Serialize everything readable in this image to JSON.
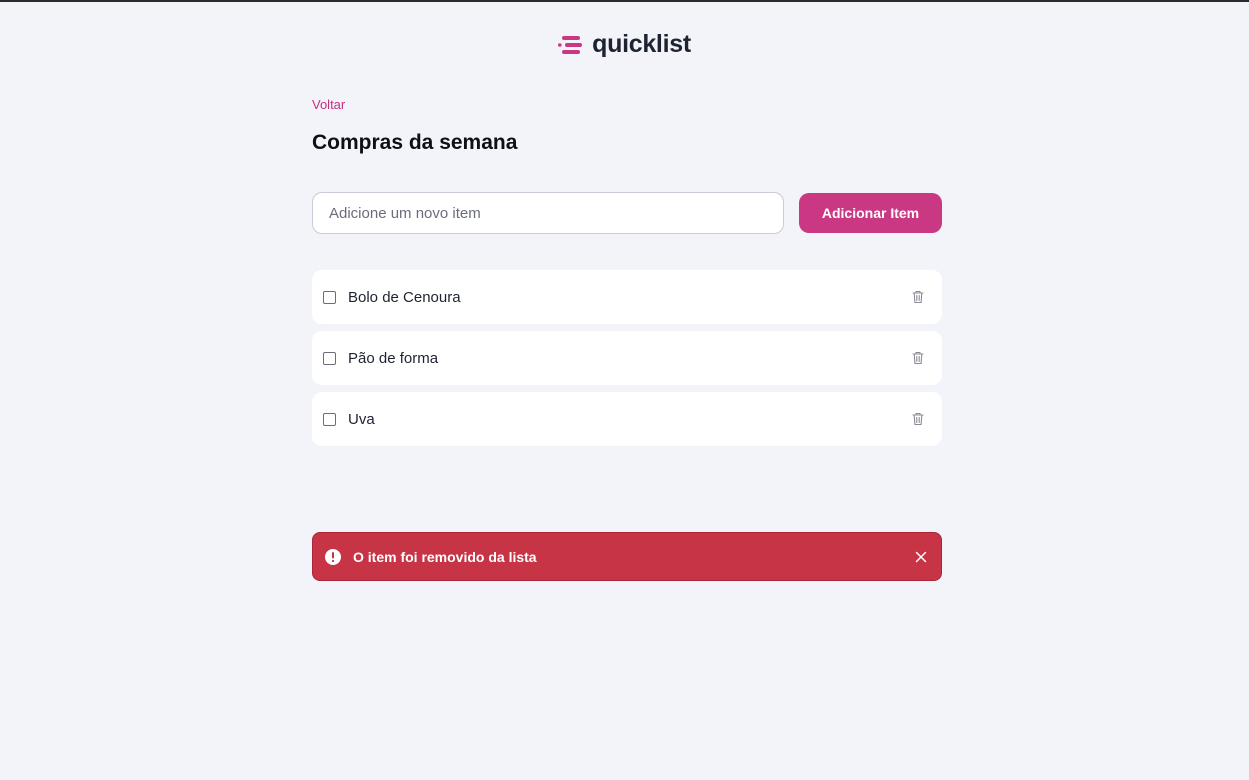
{
  "header": {
    "logo_text": "quicklist"
  },
  "back_link": "Voltar",
  "page_title": "Compras da semana",
  "add_form": {
    "placeholder": "Adicione um novo item",
    "value": "",
    "button_label": "Adicionar Item"
  },
  "items": [
    {
      "name": "Bolo de Cenoura",
      "checked": false
    },
    {
      "name": "Pão de forma",
      "checked": false
    },
    {
      "name": "Uva",
      "checked": false
    }
  ],
  "toast": {
    "message": "O item foi removido da lista",
    "icon": "alert-circle-icon",
    "close_icon": "close-icon"
  },
  "colors": {
    "brand": "#ca3884",
    "link": "#c4317d",
    "background": "#f3f4f9",
    "danger": "#c73446"
  }
}
